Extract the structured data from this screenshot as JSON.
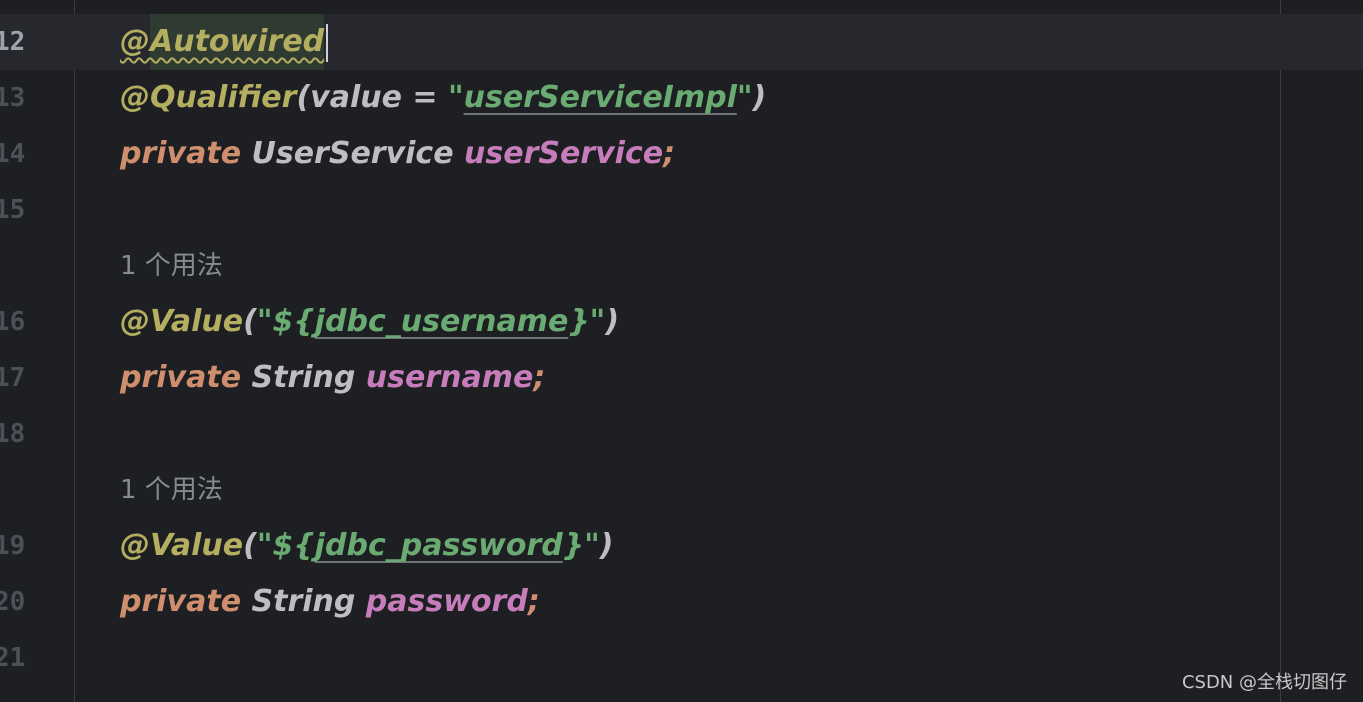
{
  "editor": {
    "lines": [
      {
        "num": "12",
        "a1": "@Autowired"
      },
      {
        "num": "13",
        "a1": "@Qualifier",
        "a2": "(value = ",
        "a3": "\"",
        "a4": "userServiceImpl",
        "a5": "\"",
        "a6": ")"
      },
      {
        "num": "14",
        "kw": "private",
        "type": " UserService ",
        "name": "userService",
        "semi": ";"
      },
      {
        "num": "15"
      },
      {
        "hint": "1 个用法"
      },
      {
        "num": "16",
        "a1": "@Value",
        "a2": "(",
        "a3": "\"${",
        "a4": "jdbc_username",
        "a5": "}\"",
        "a6": ")"
      },
      {
        "num": "17",
        "kw": "private",
        "type": " String ",
        "name": "username",
        "semi": ";"
      },
      {
        "num": "18"
      },
      {
        "hint": "1 个用法"
      },
      {
        "num": "19",
        "a1": "@Value",
        "a2": "(",
        "a3": "\"${",
        "a4": "jdbc_password",
        "a5": "}\"",
        "a6": ")"
      },
      {
        "num": "20",
        "kw": "private",
        "type": " String ",
        "name": "password",
        "semi": ";"
      },
      {
        "num": "21"
      }
    ]
  },
  "watermark": "CSDN @全栈切图仔"
}
